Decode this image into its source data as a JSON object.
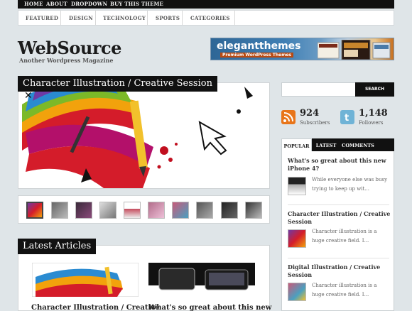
{
  "topnav": {
    "items": [
      "HOME",
      "ABOUT",
      "DROPDOWN",
      "BUY THIS THEME"
    ]
  },
  "catnav": {
    "items": [
      "FEATURED",
      "DESIGN",
      "TECHNOLOGY",
      "SPORTS",
      "CATEGORIES"
    ]
  },
  "site": {
    "title": "WebSource",
    "tagline": "Another Wordpress Magazine"
  },
  "ad": {
    "brand": "elegantthemes",
    "sub": "Premium WordPress Themes"
  },
  "featured": {
    "title": "Character Illustration / Creative Session",
    "thumb_count": 10
  },
  "latest": {
    "heading": "Latest Articles",
    "articles": [
      {
        "title": "Character Illustration / Creative"
      },
      {
        "title": "What's so great about this new"
      }
    ]
  },
  "sidebar": {
    "search_button": "SEARCH",
    "subscribers": {
      "count": "924",
      "label": "Subscribers"
    },
    "followers": {
      "count": "1,148",
      "label": "Followers"
    },
    "tabs": [
      "POPULAR",
      "LATEST",
      "COMMENTS"
    ],
    "posts": [
      {
        "title": "What's so great about this new iPhone 4?",
        "excerpt": "While everyone else was busy trying to keep up wit..."
      },
      {
        "title": "Character Illustration / Creative Session",
        "excerpt": "Character illustration is a huge creative field. I..."
      },
      {
        "title": "Digital Illustration / Creative Session",
        "excerpt": "Character illustration is a huge creative field. I..."
      }
    ]
  },
  "colors": {
    "background": "#dfe5e8",
    "dark": "#111111",
    "rss": "#e8751a",
    "twitter": "#6fb3d6"
  }
}
